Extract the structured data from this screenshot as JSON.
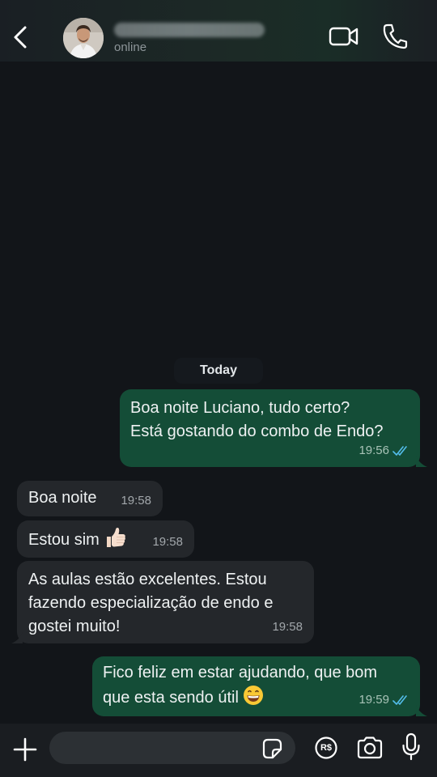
{
  "header": {
    "contact_name": "",
    "status": "online",
    "icons": [
      "back-chevron-icon",
      "video-camera-icon",
      "phone-icon"
    ]
  },
  "chat": {
    "date_label": "Today",
    "messages": [
      {
        "direction": "outgoing",
        "text": "Boa noite Luciano, tudo certo?\nEstá gostando do combo de Endo?",
        "time": "19:56",
        "status": "read"
      },
      {
        "direction": "incoming",
        "text": "Boa noite",
        "time": "19:58"
      },
      {
        "direction": "incoming",
        "text": "Estou sim",
        "emoji": "thumbs-up",
        "time": "19:58"
      },
      {
        "direction": "incoming",
        "text": "As aulas estão excelentes. Estou\nfazendo especialização de endo e\ngostei muito!",
        "time": "19:58"
      },
      {
        "direction": "outgoing",
        "text": "Fico feliz em estar ajudando, que bom\nque esta sendo útil",
        "emoji": "grinning-face",
        "time": "19:59",
        "status": "read"
      }
    ]
  },
  "input_bar": {
    "placeholder": "",
    "icons": [
      "plus-icon",
      "sticker-icon",
      "payment-icon",
      "camera-icon",
      "microphone-icon"
    ],
    "payment_label": "R$"
  },
  "colors": {
    "background": "#121519",
    "outgoing_bubble": "#144d37",
    "incoming_bubble": "#24272b",
    "read_ticks": "#53bdeb"
  }
}
